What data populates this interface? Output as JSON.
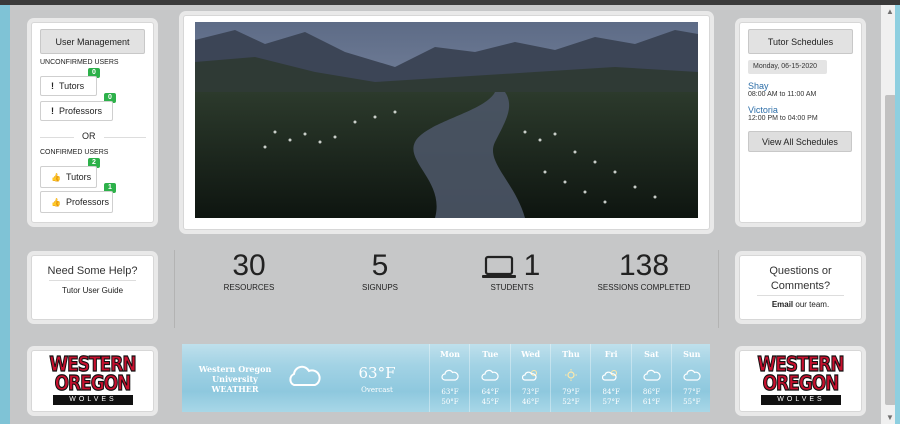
{
  "user_mgmt": {
    "title": "User Management",
    "unconfirmed_label": "UNCONFIRMED USERS",
    "tutors_label": "Tutors",
    "tutors_unconfirmed": "0",
    "professors_label": "Professors",
    "professors_unconfirmed": "0",
    "or_label": "OR",
    "confirmed_label": "CONFIRMED USERS",
    "tutors_confirmed": "2",
    "professors_confirmed": "1"
  },
  "schedules": {
    "title": "Tutor Schedules",
    "date": "Monday, 06-15-2020",
    "entries": [
      {
        "name": "Shay",
        "time": "08:00 AM to 11:00 AM"
      },
      {
        "name": "Victoria",
        "time": "12:00 PM to 04:00 PM"
      }
    ],
    "view_all": "View All Schedules"
  },
  "help": {
    "title": "Need Some Help?",
    "guide": "Tutor User Guide"
  },
  "stats": [
    {
      "value": "30",
      "label": "RESOURCES"
    },
    {
      "value": "5",
      "label": "SIGNUPS"
    },
    {
      "value": "1",
      "label": "STUDENTS",
      "icon": "laptop-icon"
    },
    {
      "value": "138",
      "label": "SESSIONS COMPLETED"
    }
  ],
  "questions": {
    "title_line1": "Questions or",
    "title_line2": "Comments?",
    "email_bold": "Email",
    "email_rest": " our team."
  },
  "logo": {
    "line1": "WESTERN",
    "line2": "OREGON",
    "line3": "WOLVES"
  },
  "weather": {
    "title_line1": "Western Oregon",
    "title_line2": "University",
    "title_line3": "WEATHER",
    "current_temp": "63°F",
    "condition": "Overcast",
    "current_icon": "cloud-icon",
    "days": [
      {
        "name": "Mon",
        "icon": "cloud-icon",
        "high": "63°F",
        "low": "50°F"
      },
      {
        "name": "Tue",
        "icon": "cloud-icon",
        "high": "64°F",
        "low": "45°F"
      },
      {
        "name": "Wed",
        "icon": "partly-cloudy-icon",
        "high": "73°F",
        "low": "46°F"
      },
      {
        "name": "Thu",
        "icon": "sun-icon",
        "high": "79°F",
        "low": "52°F"
      },
      {
        "name": "Fri",
        "icon": "partly-cloudy-icon",
        "high": "84°F",
        "low": "57°F"
      },
      {
        "name": "Sat",
        "icon": "cloud-icon",
        "high": "86°F",
        "low": "61°F"
      },
      {
        "name": "Sun",
        "icon": "cloud-icon",
        "high": "77°F",
        "low": "55°F"
      }
    ]
  },
  "colors": {
    "badge": "#2db14a",
    "link": "#2d6ea8",
    "background": "#c6c7c8",
    "logo_red": "#c8102e"
  }
}
